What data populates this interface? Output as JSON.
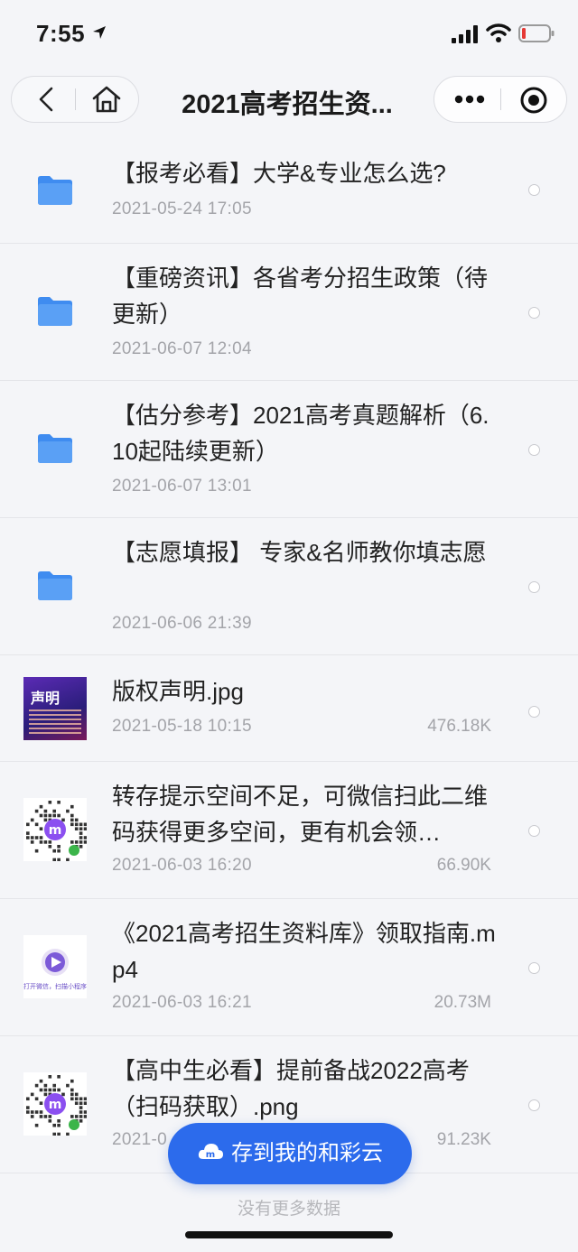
{
  "status_bar": {
    "time": "7:55"
  },
  "nav": {
    "title": "2021高考招生资..."
  },
  "files": [
    {
      "type": "folder",
      "name": "【报考必看】大学&专业怎么选?",
      "date": "2021-05-24 17:05",
      "size": ""
    },
    {
      "type": "folder",
      "name": "【重磅资讯】各省考分招生政策（待更新）",
      "date": "2021-06-07 12:04",
      "size": ""
    },
    {
      "type": "folder",
      "name": "【估分参考】2021高考真题解析（6.10起陆续更新）",
      "date": "2021-06-07 13:01",
      "size": ""
    },
    {
      "type": "folder",
      "name": "【志愿填报】 专家&名师教你填志愿",
      "date": "2021-06-06 21:39",
      "size": ""
    },
    {
      "type": "image",
      "name": "版权声明.jpg",
      "date": "2021-05-18 10:15",
      "size": "476.18K",
      "thumb_text": "声明"
    },
    {
      "type": "qr",
      "name": "转存提示空间不足，可微信扫此二维码获得更多空间，更有机会领…",
      "date": "2021-06-03 16:20",
      "size": "66.90K"
    },
    {
      "type": "video",
      "name": "《2021高考招生资料库》领取指南.mp4",
      "date": "2021-06-03 16:21",
      "size": "20.73M",
      "thumb_text": "打开微信，扫描小程序码"
    },
    {
      "type": "qr",
      "name": "【高中生必看】提前备战2022高考（扫码获取）.png",
      "date": "2021-0",
      "size": "91.23K"
    }
  ],
  "footer": {
    "no_more": "没有更多数据"
  },
  "save_button": {
    "label": "存到我的和彩云"
  },
  "colors": {
    "accent": "#2c6bec",
    "folder": "#3f8cf0",
    "battery_low": "#e53935"
  }
}
